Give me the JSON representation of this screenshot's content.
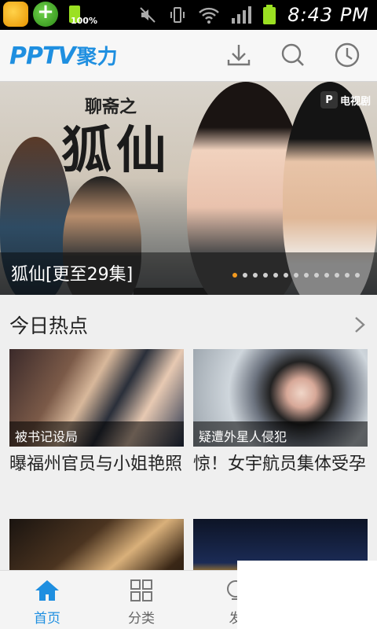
{
  "status_bar": {
    "battery_small_label": "100%",
    "time": "8:43 PM",
    "icons": [
      "app-icon-game",
      "app-icon-plus",
      "battery-icon",
      "mute-icon",
      "vibrate-icon",
      "wifi-icon",
      "signal-icon",
      "battery-icon"
    ]
  },
  "header": {
    "logo_pptv": "PPTV",
    "logo_text": "聚力",
    "actions": [
      "download-icon",
      "search-icon",
      "history-icon"
    ]
  },
  "banner": {
    "small_title": "聊斋之",
    "big_title": "狐仙",
    "badge": "电视剧",
    "badge_icon": "P",
    "caption": "狐仙[更至29集]",
    "dot_count": 13,
    "active_dot": 0
  },
  "section": {
    "title": "今日热点"
  },
  "cards": [
    {
      "thumb_label": "被书记设局",
      "title": "曝福州官员与小姐艳照"
    },
    {
      "thumb_label": "疑遭外星人侵犯",
      "title": "惊！女宇航员集体受孕"
    },
    {
      "thumb_label": "",
      "title": ""
    },
    {
      "thumb_label": "",
      "title": ""
    }
  ],
  "bottom_nav": [
    {
      "label": "首页",
      "icon": "home-icon",
      "active": true
    },
    {
      "label": "分类",
      "icon": "grid-icon",
      "active": false
    },
    {
      "label": "发",
      "icon": "discover-icon",
      "active": false
    }
  ],
  "colors": {
    "accent": "#1f8fe0",
    "dot_active": "#f39a1f"
  }
}
